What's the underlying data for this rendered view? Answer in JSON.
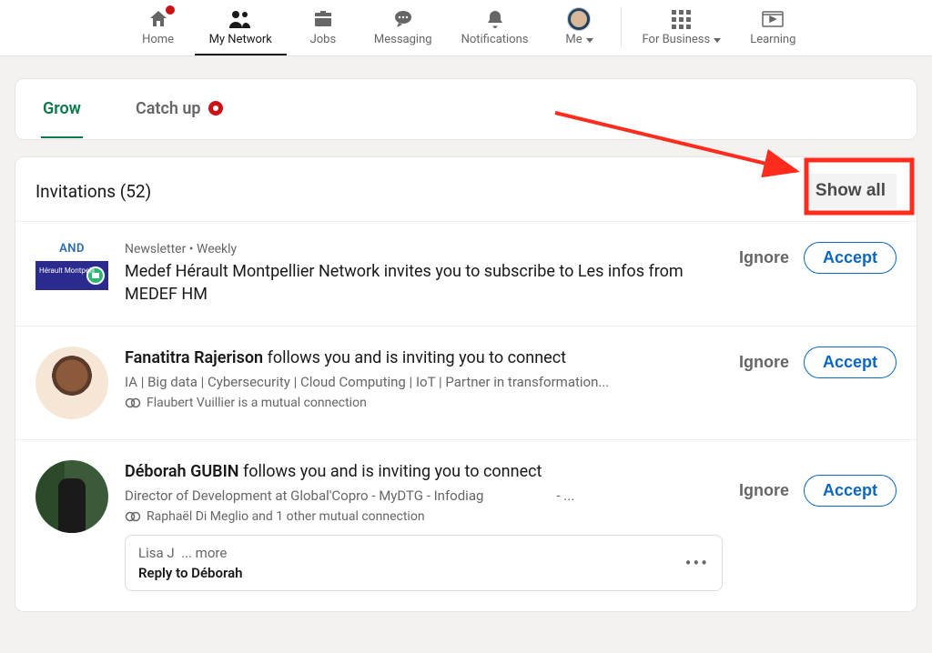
{
  "nav": {
    "home": "Home",
    "network": "My Network",
    "jobs": "Jobs",
    "messaging": "Messaging",
    "notifications": "Notifications",
    "me": "Me",
    "business": "For Business",
    "learning": "Learning"
  },
  "tabs": {
    "grow": "Grow",
    "catchup": "Catch up"
  },
  "invitations": {
    "title": "Invitations (52)",
    "show_all": "Show all"
  },
  "items": [
    {
      "badge": "AND",
      "thumb_text": "Hérault\nMontpelli",
      "meta": "Newsletter • Weekly",
      "text": "Medef Hérault Montpellier Network invites you to subscribe to Les infos from MEDEF HM",
      "ignore": "Ignore",
      "accept": "Accept"
    },
    {
      "name": "Fanatitra Rajerison",
      "follows_text": " follows you and is inviting you to connect",
      "sub": "IA | Big data | Cybersecurity |  Cloud Computing | IoT | Partner in transformation...",
      "mutual": "Flaubert Vuillier is a mutual connection",
      "ignore": "Ignore",
      "accept": "Accept"
    },
    {
      "name": "Déborah GUBIN",
      "follows_text": " follows you and is inviting you to connect",
      "sub": "Director of Development at Global'Copro - MyDTG - Infodiag",
      "sub_suffix": "- ...",
      "mutual": "Raphaël Di Meglio and 1 other mutual connection",
      "ignore": "Ignore",
      "accept": "Accept",
      "msg_preview": "Lisa J",
      "msg_more": "... more",
      "msg_reply": "Reply to Déborah"
    }
  ]
}
